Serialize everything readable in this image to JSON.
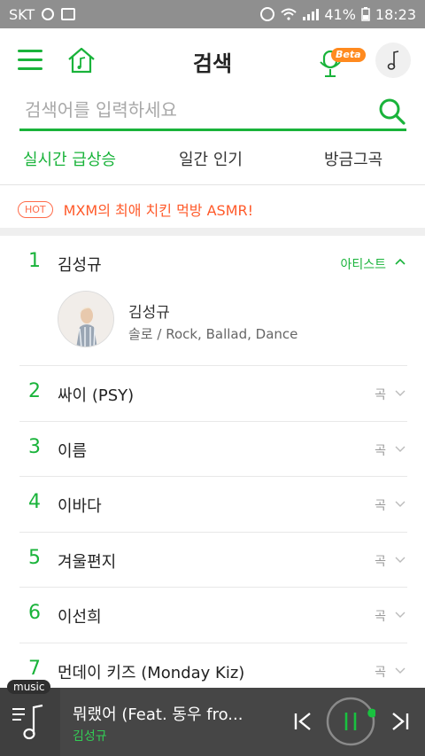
{
  "status_bar": {
    "carrier": "SKT",
    "battery": "41%",
    "time": "18:23"
  },
  "header": {
    "title": "검색",
    "beta_label": "Beta"
  },
  "search": {
    "placeholder": "검색어를 입력하세요"
  },
  "tabs": [
    {
      "label": "실시간 급상승",
      "active": true
    },
    {
      "label": "일간 인기",
      "active": false
    },
    {
      "label": "방금그곡",
      "active": false
    }
  ],
  "hot": {
    "badge": "HOT",
    "text": "MXM의 최애 치킨 먹방 ASMR!"
  },
  "ranking": [
    {
      "rank": "1",
      "name": "김성규",
      "type": "아티스트",
      "expanded": true,
      "artist": {
        "name": "김성규",
        "genre": "솔로 / Rock, Ballad, Dance"
      }
    },
    {
      "rank": "2",
      "name": "싸이 (PSY)",
      "type": "곡"
    },
    {
      "rank": "3",
      "name": "이름",
      "type": "곡"
    },
    {
      "rank": "4",
      "name": "이바다",
      "type": "곡"
    },
    {
      "rank": "5",
      "name": "겨울편지",
      "type": "곡"
    },
    {
      "rank": "6",
      "name": "이선희",
      "type": "곡"
    },
    {
      "rank": "7",
      "name": "먼데이 키즈 (Monday Kiz)",
      "type": "곡"
    }
  ],
  "player": {
    "tag": "music",
    "title": "뭐랬어 (Feat. 동우 fro...",
    "artist": "김성규",
    "progress": 0.02
  },
  "colors": {
    "accent": "#19b33a",
    "hot": "#ff5a2a",
    "player_bg": "#464646"
  }
}
